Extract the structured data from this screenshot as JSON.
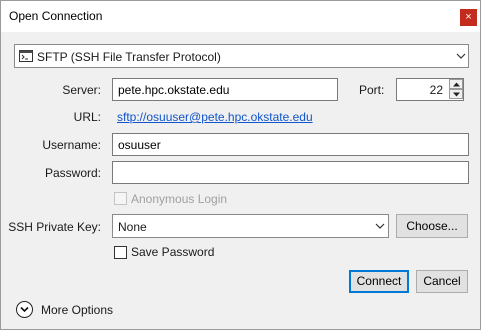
{
  "window": {
    "title": "Open Connection",
    "close_glyph": "×"
  },
  "protocol": {
    "selected": "SFTP (SSH File Transfer Protocol)",
    "icon": "sftp-terminal-icon"
  },
  "server": {
    "label": "Server:",
    "value": "pete.hpc.okstate.edu"
  },
  "port": {
    "label": "Port:",
    "value": "22"
  },
  "url": {
    "label": "URL:",
    "value": "sftp://osuuser@pete.hpc.okstate.edu"
  },
  "username": {
    "label": "Username:",
    "value": "osuuser"
  },
  "password": {
    "label": "Password:",
    "value": ""
  },
  "anonymous": {
    "label": "Anonymous Login",
    "checked": false,
    "enabled": false
  },
  "ssh_key": {
    "label": "SSH Private Key:",
    "selected": "None",
    "choose_label": "Choose..."
  },
  "save_password": {
    "label": "Save Password",
    "checked": false
  },
  "actions": {
    "connect_label": "Connect",
    "cancel_label": "Cancel"
  },
  "more_options": {
    "label": "More Options",
    "icon": "chevron-down-circle-icon"
  },
  "colors": {
    "link": "#1155cc",
    "close_bg": "#c42b1c",
    "default_button_border": "#0078d7"
  }
}
